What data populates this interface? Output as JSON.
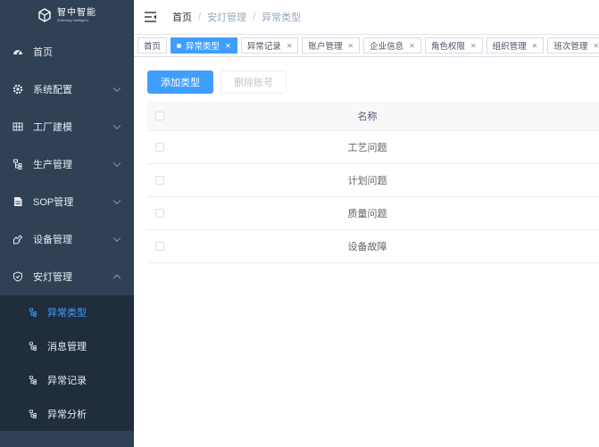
{
  "logo": {
    "name_cn": "智中智能",
    "name_en": "Zhizhong Intelligent"
  },
  "sidebar": {
    "items": [
      {
        "label": "首页",
        "icon": "dashboard-icon",
        "has_children": false
      },
      {
        "label": "系统配置",
        "icon": "gear-icon",
        "has_children": true
      },
      {
        "label": "工厂建模",
        "icon": "grid-icon",
        "has_children": true
      },
      {
        "label": "生产管理",
        "icon": "tree-icon",
        "has_children": true
      },
      {
        "label": "SOP管理",
        "icon": "document-icon",
        "has_children": true
      },
      {
        "label": "设备管理",
        "icon": "tool-icon",
        "has_children": true
      },
      {
        "label": "安灯管理",
        "icon": "shield-icon",
        "has_children": true,
        "expanded": true
      }
    ],
    "subitems": [
      {
        "label": "异常类型",
        "icon": "tree-icon",
        "active": true
      },
      {
        "label": "消息管理",
        "icon": "tree-icon",
        "active": false
      },
      {
        "label": "异常记录",
        "icon": "tree-icon",
        "active": false
      },
      {
        "label": "异常分析",
        "icon": "tree-icon",
        "active": false
      }
    ]
  },
  "header": {
    "breadcrumb": [
      "首页",
      "安灯管理",
      "异常类型"
    ],
    "separator": "/"
  },
  "tags": [
    {
      "label": "首页",
      "closable": false,
      "active": false
    },
    {
      "label": "异常类型",
      "closable": true,
      "active": true
    },
    {
      "label": "异常记录",
      "closable": true,
      "active": false
    },
    {
      "label": "账户管理",
      "closable": true,
      "active": false
    },
    {
      "label": "企业信息",
      "closable": true,
      "active": false
    },
    {
      "label": "角色权限",
      "closable": true,
      "active": false
    },
    {
      "label": "组织管理",
      "closable": true,
      "active": false
    },
    {
      "label": "班次管理",
      "closable": true,
      "active": false
    }
  ],
  "toolbar": {
    "add_label": "添加类型",
    "delete_label": "删除账号"
  },
  "table": {
    "header": "名称",
    "rows": [
      "工艺问题",
      "计划问题",
      "质量问题",
      "设备故障"
    ]
  },
  "colors": {
    "sidebar_bg": "#304156",
    "submenu_bg": "#1f2d3d",
    "primary": "#409eff"
  }
}
